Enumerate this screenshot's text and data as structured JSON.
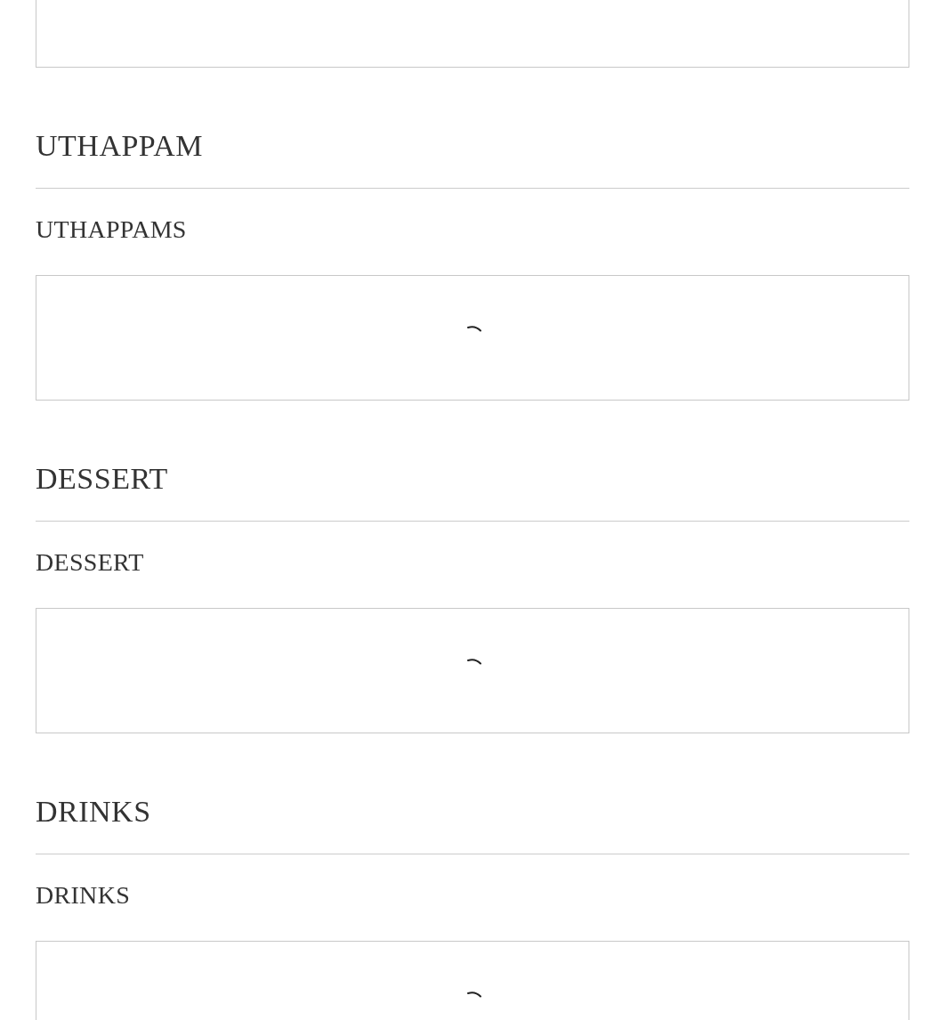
{
  "sections": [
    {
      "title": "UTHAPPAM",
      "subtitle": "UTHAPPAMS",
      "panel": {
        "loading": true
      }
    },
    {
      "title": "DESSERT",
      "subtitle": "DESSERT",
      "panel": {
        "loading": true
      }
    },
    {
      "title": "DRINKS",
      "subtitle": "DRINKS",
      "panel": {
        "loading": true
      }
    }
  ]
}
